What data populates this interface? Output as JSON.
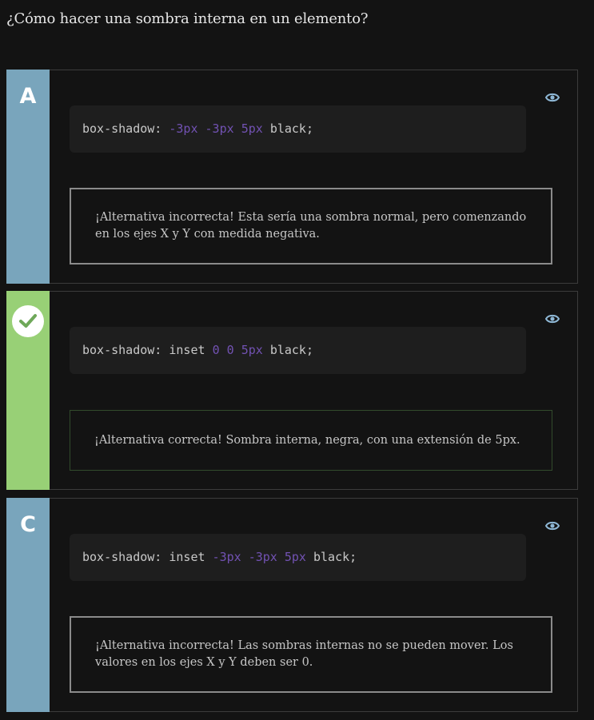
{
  "question": "¿Cómo hacer una sombra interna en un elemento?",
  "colors": {
    "side_incorrect": "#79a5bc",
    "side_correct": "#98d076",
    "number_token": "#7252b3",
    "eye_icon": "#8fb8d6"
  },
  "options": [
    {
      "letter": "A",
      "status": "incorrect",
      "code": {
        "prop": "box-shadow: ",
        "v1": "-3px",
        "v2": "-3px",
        "v3": "5px",
        "tail": "black;"
      },
      "feedback": "¡Alternativa incorrecta! Esta sería una sombra normal, pero comenzando en los ejes X y Y con medida negativa."
    },
    {
      "letter": "",
      "status": "correct",
      "code": {
        "prop": "box-shadow: inset ",
        "v1": "0",
        "v2": "0",
        "v3": "5px",
        "tail": "black;"
      },
      "feedback": "¡Alternativa correcta! Sombra interna, negra, con una extensión de 5px."
    },
    {
      "letter": "C",
      "status": "incorrect",
      "code": {
        "prop": "box-shadow: inset ",
        "v1": "-3px",
        "v2": "-3px",
        "v3": "5px",
        "tail": "black;"
      },
      "feedback": "¡Alternativa incorrecta! Las sombras internas no se pueden mover. Los valores en los ejes X y Y deben ser 0."
    }
  ],
  "icons": {
    "eye": "eye-icon",
    "check": "check-icon"
  }
}
